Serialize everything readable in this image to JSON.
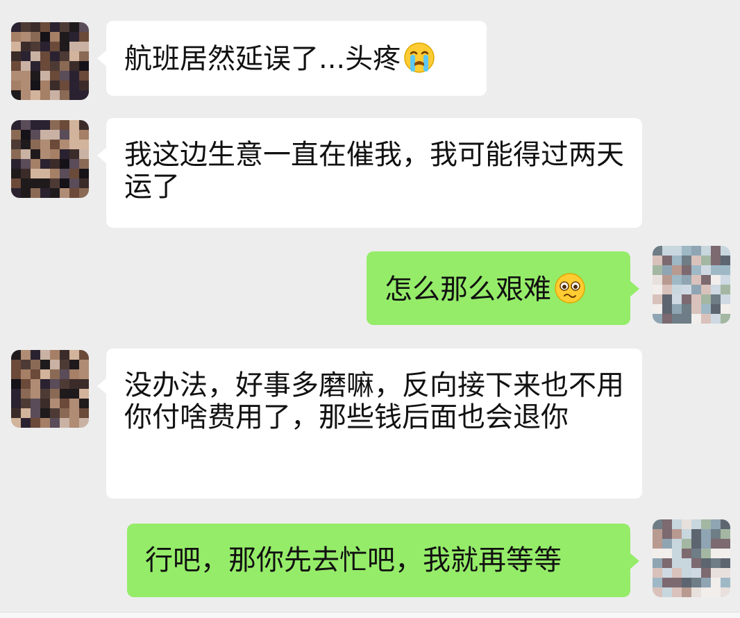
{
  "chat": {
    "messages": [
      {
        "side": "in",
        "text": "航班居然延误了...头疼",
        "emoji": "crying-face-emoji"
      },
      {
        "side": "in",
        "text": "我这边生意一直在催我，我可能得过两天运了"
      },
      {
        "side": "out",
        "text": "怎么那么艰难",
        "emoji": "pleading-face-emoji"
      },
      {
        "side": "in",
        "text": "没办法，好事多磨嘛，反向接下来也不用你付啥费用了，那些钱后面也会退你"
      },
      {
        "side": "out",
        "text": "行吧，那你先去忙吧，我就再等等"
      }
    ]
  },
  "colors": {
    "background": "#ededed",
    "incoming_bubble": "#ffffff",
    "outgoing_bubble": "#95ec69",
    "text": "#111111"
  }
}
